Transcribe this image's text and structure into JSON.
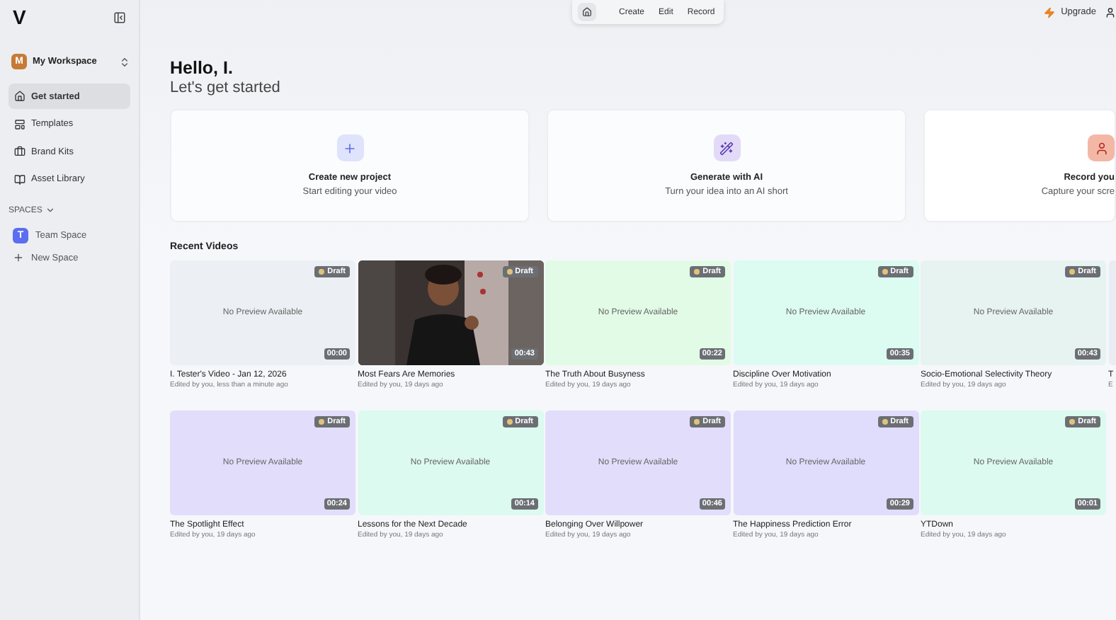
{
  "sidebar": {
    "logo": "V",
    "workspace": {
      "initial": "M",
      "name": "My Workspace"
    },
    "items": [
      {
        "label": "Get started",
        "selected": true
      },
      {
        "label": "Templates",
        "selected": false
      },
      {
        "label": "Brand Kits",
        "selected": false
      },
      {
        "label": "Asset Library",
        "selected": false
      }
    ],
    "spaces_heading": "SPACES",
    "expanded": true,
    "spaces": [
      {
        "initial": "T",
        "name": "Team Space"
      }
    ],
    "new_space": "New Space"
  },
  "top_nav": {
    "items": [
      {
        "label": "Create"
      },
      {
        "label": "Edit"
      },
      {
        "label": "Record"
      }
    ]
  },
  "upgrade": "Upgrade",
  "greeting": "Hello, I.",
  "subtitle": "Let's get started",
  "actions": [
    {
      "kind": "create",
      "title": "Create new project",
      "text": "Start editing your video"
    },
    {
      "kind": "ai",
      "title": "Generate with AI",
      "text": "Turn your idea into an AI short"
    },
    {
      "kind": "record",
      "title": "Record you",
      "text": "Capture your scre"
    }
  ],
  "recent_heading": "Recent Videos",
  "videos": [
    {
      "kind": "blank",
      "color": "#eceff3",
      "preview": "No Preview Available",
      "badge": "Draft",
      "duration": "00:00",
      "title": "I. Tester's Video - Jan 12, 2026",
      "meta": "Edited by you, less than a minute ago"
    },
    {
      "kind": "picture",
      "badge": "Draft",
      "duration": "00:43",
      "title": "Most Fears Are Memories",
      "meta": "Edited by you, 19 days ago"
    },
    {
      "kind": "blank",
      "color": "#e2fbe6",
      "preview": "No Preview Available",
      "badge": "Draft",
      "duration": "00:22",
      "title": "The Truth About Busyness",
      "meta": "Edited by you, 19 days ago"
    },
    {
      "kind": "blank",
      "color": "#dcfbf1",
      "preview": "No Preview Available",
      "badge": "Draft",
      "duration": "00:35",
      "title": "Discipline Over Motivation",
      "meta": "Edited by you, 19 days ago"
    },
    {
      "kind": "blank",
      "color": "#e7f3f0",
      "preview": "No Preview Available",
      "badge": "Draft",
      "duration": "00:43",
      "title": "Socio-Emotional Selectivity Theory",
      "meta": "Edited by you, 19 days ago"
    },
    {
      "kind": "blank",
      "color": "#e9ecf2",
      "title": "T",
      "meta": "E"
    },
    {
      "kind": "blank",
      "color": "#e2ddfb",
      "preview": "No Preview Available",
      "badge": "Draft",
      "duration": "00:24",
      "title": "The Spotlight Effect",
      "meta": "Edited by you, 19 days ago"
    },
    {
      "kind": "blank",
      "color": "#dcfaef",
      "preview": "No Preview Available",
      "badge": "Draft",
      "duration": "00:14",
      "title": "Lessons for the Next Decade",
      "meta": "Edited by you, 19 days ago"
    },
    {
      "kind": "blank",
      "color": "#e2ddfb",
      "preview": "No Preview Available",
      "badge": "Draft",
      "duration": "00:46",
      "title": "Belonging Over Willpower",
      "meta": "Edited by you, 19 days ago"
    },
    {
      "kind": "blank",
      "color": "#e0dcfb",
      "preview": "No Preview Available",
      "badge": "Draft",
      "duration": "00:29",
      "title": "The Happiness Prediction Error",
      "meta": "Edited by you, 19 days ago"
    },
    {
      "kind": "blank",
      "color": "#dcfaf0",
      "preview": "No Preview Available",
      "badge": "Draft",
      "duration": "00:01",
      "title": "YTDown",
      "meta": "Edited by you, 19 days ago"
    }
  ]
}
